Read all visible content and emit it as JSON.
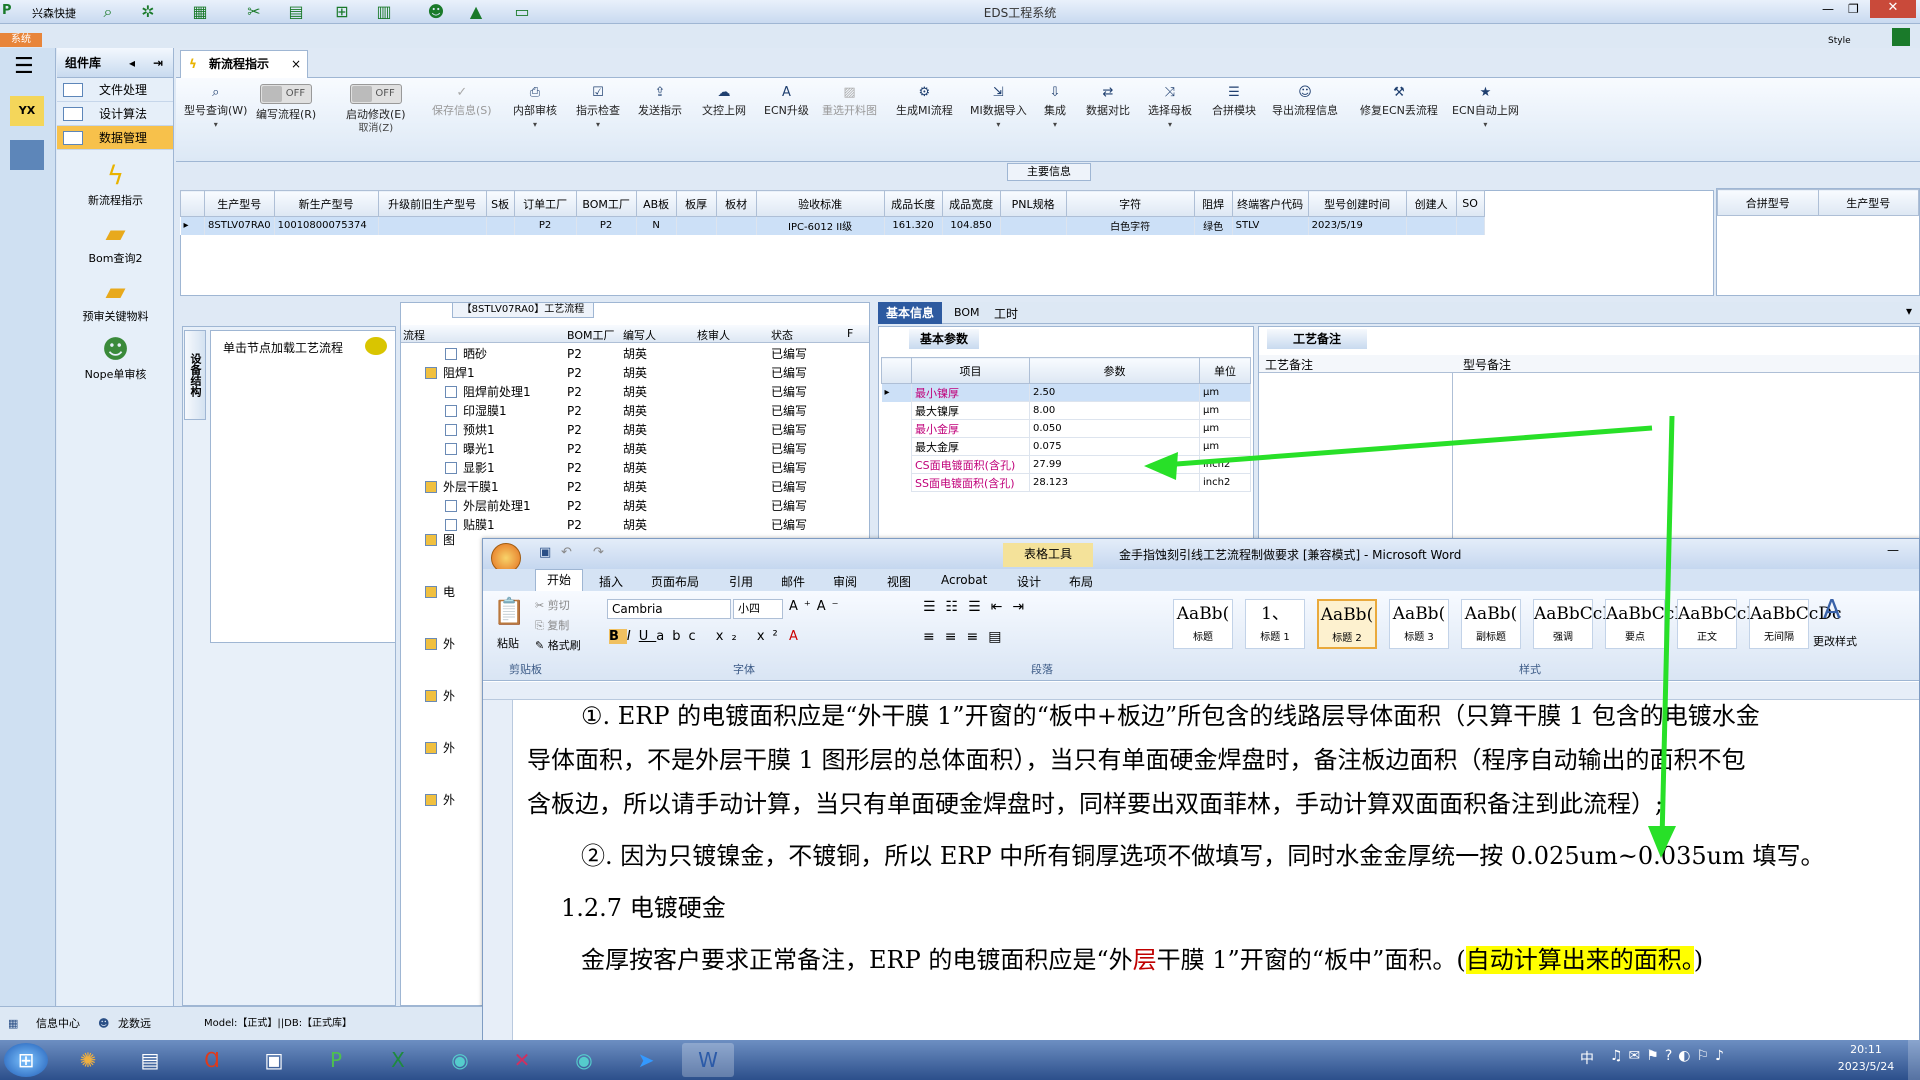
{
  "titlebar": {
    "app_label": "兴森快捷",
    "window_title": "EDS工程系统",
    "style_label": "Style"
  },
  "systab": {
    "label": "系统"
  },
  "left_panel": {
    "title": "组件库",
    "items": [
      {
        "label": "文件处理"
      },
      {
        "label": "设计算法"
      },
      {
        "label": "数据管理"
      }
    ],
    "big_items": [
      {
        "label": "新流程指示",
        "icon": "lightning-icon"
      },
      {
        "label": "Bom查询2",
        "icon": "folder-icon"
      },
      {
        "label": "预审关键物料",
        "icon": "folder-icon"
      },
      {
        "label": "Nope单审核",
        "icon": "user-icon"
      }
    ]
  },
  "tab": {
    "label": "新流程指示",
    "close": "×"
  },
  "toolbar": {
    "items": [
      {
        "label": "型号查询(W)",
        "icon": "search-icon"
      },
      {
        "label": "编写流程(R)",
        "toggle": "OFF"
      },
      {
        "label": "启动修改(E)",
        "sub": "取消(Z)",
        "toggle": "OFF"
      },
      {
        "label": "保存信息(S)",
        "icon": "check-icon"
      },
      {
        "label": "内部审核",
        "icon": "printer-icon"
      },
      {
        "label": "指示检查",
        "icon": "checklist-icon"
      },
      {
        "label": "发送指示",
        "icon": "upload-icon"
      },
      {
        "label": "文控上网",
        "icon": "cloud-icon"
      },
      {
        "label": "ECN升级",
        "icon": "a-icon"
      },
      {
        "label": "重选开料图",
        "icon": "image-icon"
      },
      {
        "label": "生成MI流程",
        "icon": "gears-icon"
      },
      {
        "label": "MI数据导入",
        "icon": "import-icon"
      },
      {
        "label": "集成",
        "icon": "download-icon"
      },
      {
        "label": "数据对比",
        "icon": "compare-icon"
      },
      {
        "label": "选择母板",
        "icon": "shuffle-icon"
      },
      {
        "label": "合拼模块",
        "icon": "list-icon"
      },
      {
        "label": "导出流程信息",
        "icon": "smile-icon"
      },
      {
        "label": "修复ECN丢流程",
        "icon": "wrench-icon"
      },
      {
        "label": "ECN自动上网",
        "icon": "star-icon"
      }
    ],
    "section_label": "主要信息"
  },
  "main_table": {
    "headers": [
      "生产型号",
      "新生产型号",
      "升级前旧生产型号",
      "S板",
      "订单工厂",
      "BOM工厂",
      "AB板",
      "板厚",
      "板材",
      "验收标准",
      "成品长度",
      "成品宽度",
      "PNL规格",
      "字符",
      "阻焊",
      "终端客户代码",
      "型号创建时间",
      "创建人",
      "SO"
    ],
    "row": [
      "8STLV07RA0",
      "10010800075374",
      "",
      "",
      "P2",
      "P2",
      "N",
      "",
      "",
      "IPC-6012 II级",
      "161.320",
      "104.850",
      "",
      "白色字符",
      "绿色",
      "STLV",
      "2023/5/19",
      "",
      ""
    ]
  },
  "side_table": {
    "headers": [
      "合拼型号",
      "生产型号"
    ]
  },
  "vertical_tab": {
    "label": "设备结构"
  },
  "click_load": {
    "label": "单击节点加载工艺流程"
  },
  "process_tree": {
    "title": "【8STLV07RA0】工艺流程",
    "headers": [
      "流程",
      "BOM工厂",
      "编写人",
      "核审人",
      "状态",
      "F"
    ],
    "rows": [
      {
        "name": "晒砂",
        "bom": "P2",
        "writer": "胡英",
        "status": "已编写",
        "level": 2
      },
      {
        "name": "阻焊1",
        "bom": "P2",
        "writer": "胡英",
        "status": "已编写",
        "level": 1
      },
      {
        "name": "阻焊前处理1",
        "bom": "P2",
        "writer": "胡英",
        "status": "已编写",
        "level": 2
      },
      {
        "name": "印湿膜1",
        "bom": "P2",
        "writer": "胡英",
        "status": "已编写",
        "level": 2
      },
      {
        "name": "预烘1",
        "bom": "P2",
        "writer": "胡英",
        "status": "已编写",
        "level": 2
      },
      {
        "name": "曝光1",
        "bom": "P2",
        "writer": "胡英",
        "status": "已编写",
        "level": 2
      },
      {
        "name": "显影1",
        "bom": "P2",
        "writer": "胡英",
        "status": "已编写",
        "level": 2
      },
      {
        "name": "外层干膜1",
        "bom": "P2",
        "writer": "胡英",
        "status": "已编写",
        "level": 1
      },
      {
        "name": "外层前处理1",
        "bom": "P2",
        "writer": "胡英",
        "status": "已编写",
        "level": 2
      },
      {
        "name": "贴膜1",
        "bom": "P2",
        "writer": "胡英",
        "status": "已编写",
        "level": 2
      }
    ],
    "partial": [
      "图",
      "电",
      "外",
      "外",
      "外",
      "外"
    ]
  },
  "param_tabs": [
    "基本信息",
    "BOM",
    "工时"
  ],
  "basic_params": {
    "title": "基本参数",
    "headers": [
      "项目",
      "参数",
      "单位"
    ],
    "rows": [
      {
        "item": "最小镍厚",
        "value": "2.50",
        "unit": "μm",
        "color": "#c0007a"
      },
      {
        "item": "最大镍厚",
        "value": "8.00",
        "unit": "μm",
        "color": "#000000"
      },
      {
        "item": "最小金厚",
        "value": "0.050",
        "unit": "μm",
        "color": "#c0007a"
      },
      {
        "item": "最大金厚",
        "value": "0.075",
        "unit": "μm",
        "color": "#000000"
      },
      {
        "item": "CS面电镀面积(含孔)",
        "value": "27.99",
        "unit": "inch2",
        "color": "#c0007a"
      },
      {
        "item": "SS面电镀面积(含孔)",
        "value": "28.123",
        "unit": "inch2",
        "color": "#c0007a"
      }
    ]
  },
  "remarks": {
    "title": "工艺备注",
    "col1": "工艺备注",
    "col2": "型号备注"
  },
  "word": {
    "title": "金手指蚀刻引线工艺流程制做要求 [兼容模式] - Microsoft Word",
    "context_tab": "表格工具",
    "tabs": [
      "开始",
      "插入",
      "页面布局",
      "引用",
      "邮件",
      "审阅",
      "视图",
      "Acrobat",
      "设计",
      "布局"
    ],
    "clipboard": {
      "paste": "粘贴",
      "cut": "剪切",
      "copy": "复制",
      "painter": "格式刷",
      "group": "剪贴板"
    },
    "font": {
      "name": "Cambria",
      "size": "小四",
      "group": "字体"
    },
    "paragraph_group": "段落",
    "styles": [
      {
        "preview": "AaBb(",
        "name": "标题"
      },
      {
        "preview": "1、",
        "name": "标题 1"
      },
      {
        "preview": "AaBb(",
        "name": "标题 2"
      },
      {
        "preview": "AaBb(",
        "name": "标题 3"
      },
      {
        "preview": "AaBb(",
        "name": "副标题"
      },
      {
        "preview": "AaBbCcD",
        "name": "强调"
      },
      {
        "preview": "AaBbCcD",
        "name": "要点"
      },
      {
        "preview": "AaBbCcDc",
        "name": "正文"
      },
      {
        "preview": "AaBbCcDc",
        "name": "无间隔"
      }
    ],
    "styles_group": "样式",
    "change_styles": "更改样式",
    "doc": {
      "p1a": "①. ERP 的电镀面积应是“外干膜 1”开窗的“板中+板边”所包含的线路层导体面积（只算干膜 1 包含的电镀水金",
      "p1b": "导体面积，不是外层干膜 1 图形层的总体面积），当只有单面硬金焊盘时，备注板边面积（程序自动输出的面积不包",
      "p1c": "含板边，所以请手动计算，当只有单面硬金焊盘时，同样要出双面菲林，手动计算双面面积备注到此流程）;",
      "p2": "②. 因为只镀镍金，不镀铜，所以 ERP 中所有铜厚选项不做填写，同时水金金厚统一按 0.025um~0.035um 填写。",
      "h": "1.2.7    电镀硬金",
      "p3a": "金厚按客户要求正常备注，ERP  的电镀面积应是“外",
      "p3b": "层",
      "p3c": "干膜 1”开窗的“板中”面积。(",
      "p3d": "自动计算出来的面积。",
      "p3e": ")"
    }
  },
  "statusbar": {
    "info": "信息中心",
    "user": "龙数远",
    "model": "Model:【正式】||DB:【正式库】"
  },
  "taskbar": {
    "time": "20:11",
    "date": "2023/5/24",
    "lang": "中"
  }
}
